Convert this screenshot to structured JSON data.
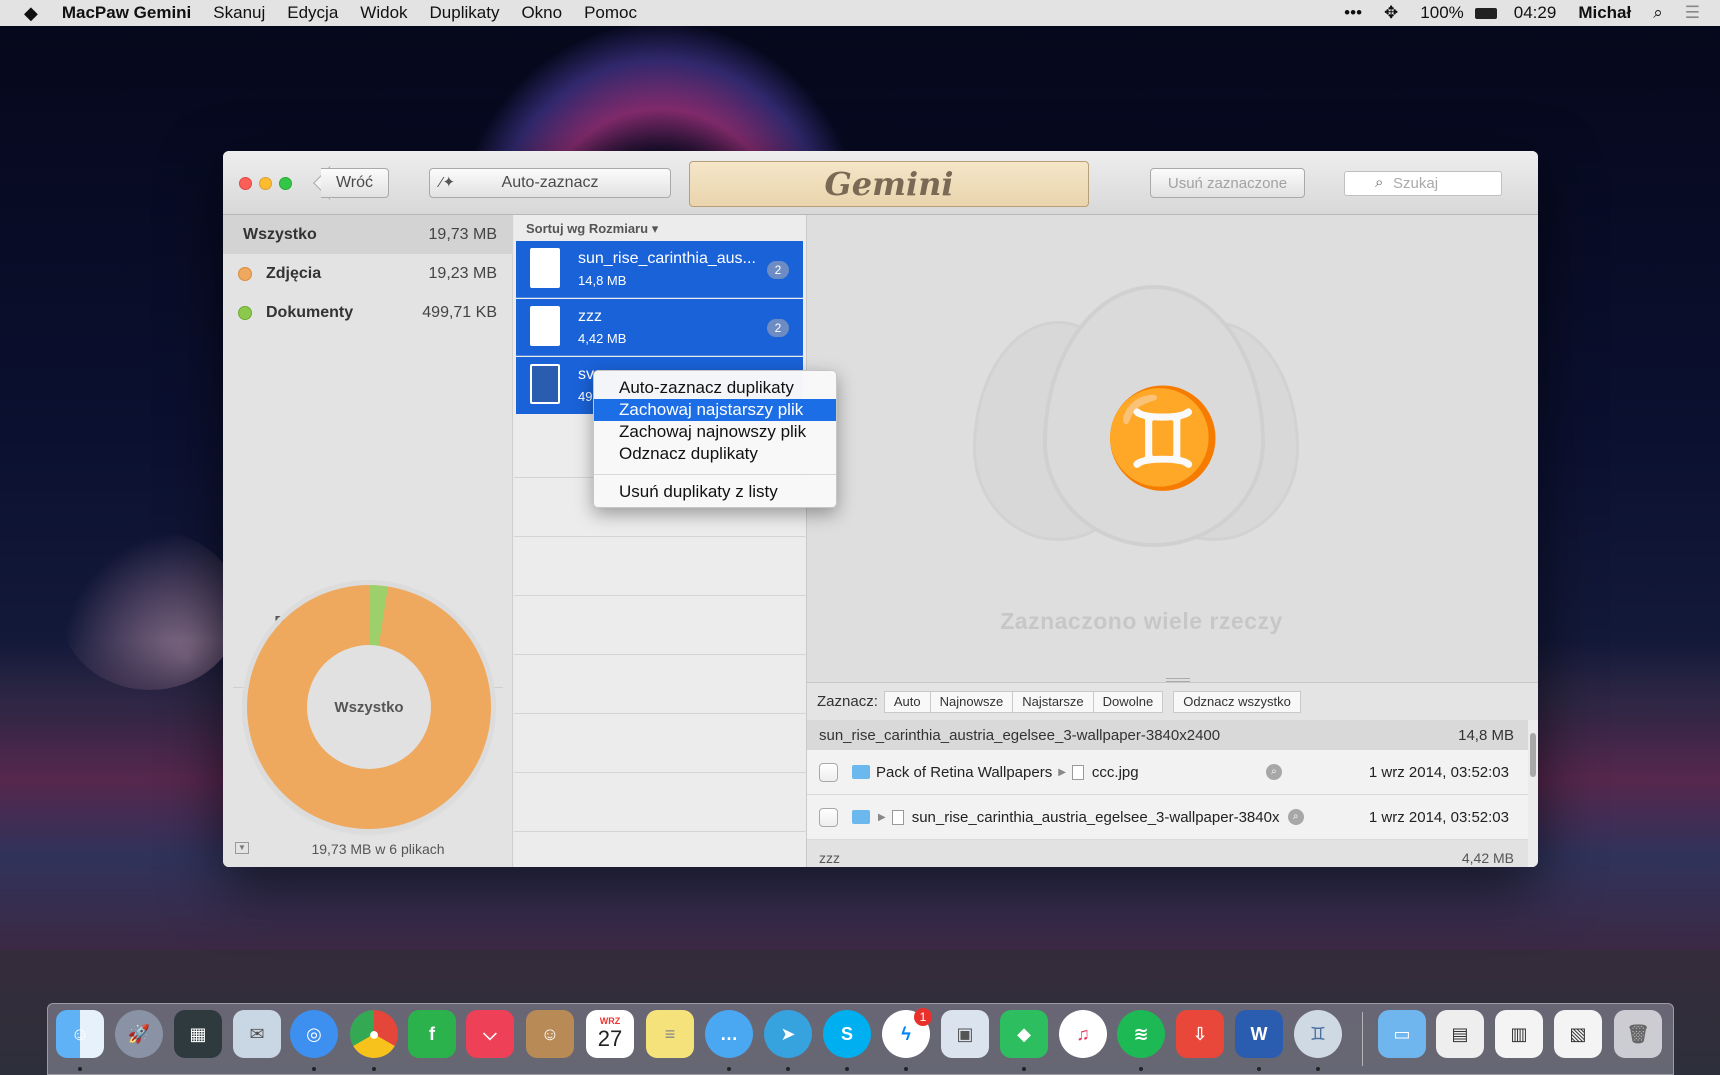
{
  "menubar": {
    "app_name": "MacPaw Gemini",
    "menus": [
      "Skanuj",
      "Edycja",
      "Widok",
      "Duplikaty",
      "Okno",
      "Pomoc"
    ],
    "battery": "100%",
    "time": "04:29",
    "user": "Michał"
  },
  "toolbar": {
    "back_label": "Wróć",
    "auto_select_label": "Auto-zaznacz",
    "logo_text": "Gemini",
    "delete_selected_label": "Usuń zaznaczone",
    "search_placeholder": "Szukaj"
  },
  "sidebar": {
    "items": [
      {
        "label": "Wszystko",
        "size": "19,73 MB",
        "color": ""
      },
      {
        "label": "Zdjęcia",
        "size": "19,23 MB",
        "color": "#eea95f"
      },
      {
        "label": "Dokumenty",
        "size": "499,71 KB",
        "color": "#8cc84b"
      }
    ],
    "pack_title": "Pack of Retina Wallpapers",
    "donut_center": "Wszystko",
    "footer": "19,73 MB w 6 plikach",
    "share_documents": 0.025
  },
  "file_list": {
    "sort_label": "Sortuj wg Rozmiaru",
    "items": [
      {
        "name": "sun_rise_carinthia_aus...",
        "size": "14,8 MB",
        "count": "2",
        "icon": "jpeg-icon"
      },
      {
        "name": "zzz",
        "size": "4,42 MB",
        "count": "2",
        "icon": "jpeg-icon"
      },
      {
        "name": "sv",
        "size": "49",
        "count": "",
        "icon": "word-doc-icon"
      }
    ]
  },
  "context_menu": {
    "items": [
      "Auto-zaznacz duplikaty",
      "Zachowaj najstarszy plik",
      "Zachowaj najnowszy plik",
      "Odznacz duplikaty"
    ],
    "highlighted": "Zachowaj najstarszy plik",
    "footer_item": "Usuń duplikaty z listy"
  },
  "detail": {
    "message": "Zaznaczono wiele rzeczy"
  },
  "select_bar": {
    "label": "Zaznacz:",
    "options": [
      "Auto",
      "Najnowsze",
      "Najstarsze",
      "Dowolne"
    ],
    "unselect_all": "Odznacz wszystko"
  },
  "duplicate_group": {
    "name": "sun_rise_carinthia_austria_egelsee_3-wallpaper-3840x2400",
    "size": "14,8 MB",
    "rows": [
      {
        "folder": "Pack of Retina Wallpapers",
        "file": "ccc.jpg",
        "date": "1 wrz 2014, 03:52:03"
      },
      {
        "folder": "",
        "file": "sun_rise_carinthia_austria_egelsee_3-wallpaper-3840x",
        "date": "1 wrz 2014, 03:52:03"
      }
    ]
  },
  "next_group": {
    "name": "zzz",
    "size": "4,42 MB"
  },
  "dock": {
    "calendar_month": "WRZ",
    "calendar_day": "27",
    "messenger_badge": "1"
  }
}
